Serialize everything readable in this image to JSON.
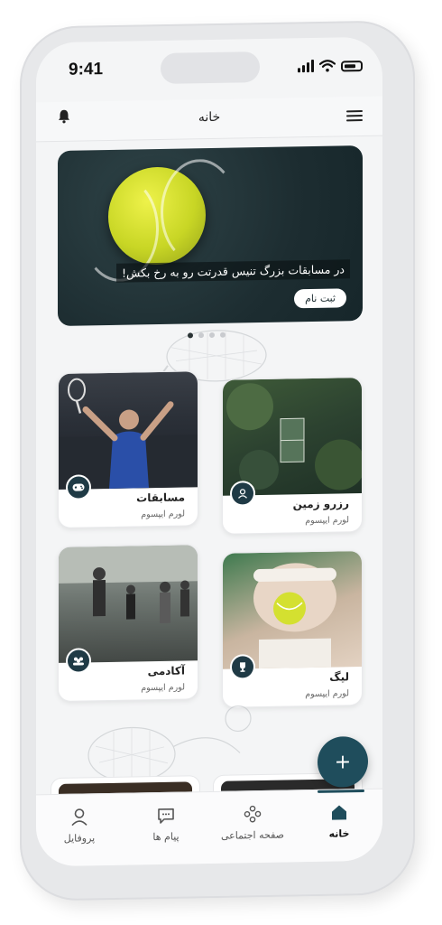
{
  "status_bar": {
    "time": "9:41"
  },
  "header": {
    "title": "خانه"
  },
  "banner": {
    "text": "در مسابقات بزرگ تنیس قدرتت رو به رخ بکش!",
    "button_label": "ثبت نام"
  },
  "cards": [
    {
      "title": "مسابقات",
      "subtitle": "لورم ایپسوم",
      "icon": "gamepad-icon"
    },
    {
      "title": "رزرو زمین",
      "subtitle": "لورم ایپسوم",
      "icon": "user-check-icon"
    },
    {
      "title": "آکادمی",
      "subtitle": "لورم ایپسوم",
      "icon": "group-icon"
    },
    {
      "title": "لیگ",
      "subtitle": "لورم ایپسوم",
      "icon": "trophy-icon"
    }
  ],
  "fab": {
    "label": "+"
  },
  "bottom_nav": {
    "items": [
      {
        "label": "پروفایل",
        "icon": "user-icon"
      },
      {
        "label": "پیام ها",
        "icon": "chat-icon"
      },
      {
        "label": "صفحه اجتماعی",
        "icon": "community-icon"
      },
      {
        "label": "خانه",
        "icon": "home-icon"
      }
    ],
    "active": "خانه"
  },
  "colors": {
    "accent": "#1f4d5c",
    "background": "#f4f5f6"
  }
}
